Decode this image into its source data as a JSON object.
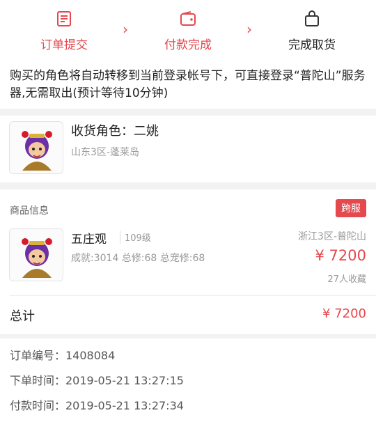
{
  "steps": [
    {
      "label": "订单提交",
      "icon": "receipt-icon"
    },
    {
      "label": "付款完成",
      "icon": "wallet-icon"
    },
    {
      "label": "完成取货",
      "icon": "bag-icon"
    }
  ],
  "notice": "购买的角色将自动转移到当前登录帐号下，可直接登录“普陀山”服务器,无需取出(预计等待10分钟)",
  "role": {
    "name": "收货角色：二姚",
    "server": "山东3区-蓬莱岛"
  },
  "goods": {
    "title": "商品信息",
    "badge": "跨服",
    "item_name": "五庄观",
    "item_level": "109级",
    "item_stats": "成就:3014 总修:68 总宠修:68",
    "item_server": "浙江3区-普陀山",
    "item_price": "¥ 7200",
    "item_fav": "27人收藏",
    "total_label": "总计",
    "total_value": "¥ 7200"
  },
  "order": {
    "number": "订单编号：1408084",
    "order_time": "下单时间：2019-05-21 13:27:15",
    "pay_time": "付款时间：2019-05-21 13:27:34"
  },
  "colors": {
    "accent": "#e5484d",
    "muted": "#999999",
    "background": "#f2f2f2"
  }
}
